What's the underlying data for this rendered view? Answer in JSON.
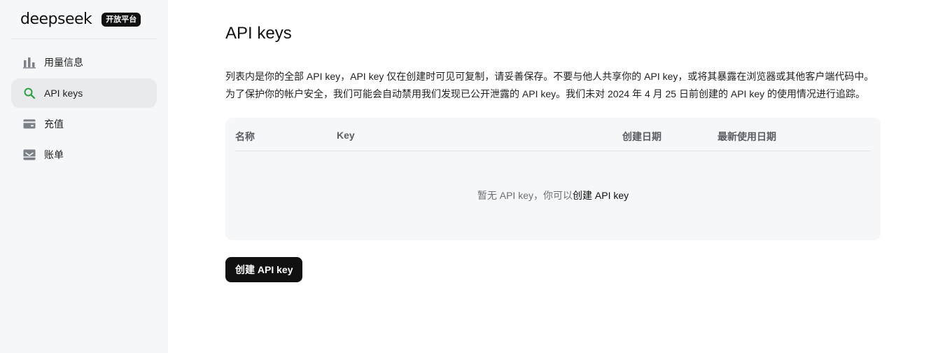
{
  "brand": {
    "name": "deepseek",
    "badge": "开放平台"
  },
  "sidebar": {
    "items": [
      {
        "label": "用量信息",
        "icon": "bar-chart-icon",
        "active": false
      },
      {
        "label": "API keys",
        "icon": "search-icon",
        "active": true,
        "icon_color": "#2e9f46"
      },
      {
        "label": "充值",
        "icon": "card-icon",
        "active": false
      },
      {
        "label": "账单",
        "icon": "inbox-icon",
        "active": false
      }
    ]
  },
  "main": {
    "title": "API keys",
    "description": [
      "列表内是你的全部 API key，API key 仅在创建时可见可复制，请妥善保存。不要与他人共享你的 API key，或将其暴露在浏览器或其他客户端代码中。",
      "为了保护你的帐户安全，我们可能会自动禁用我们发现已公开泄露的 API key。我们未对 2024 年 4 月 25 日前创建的 API key 的使用情况进行追踪。"
    ],
    "table": {
      "columns": [
        "名称",
        "Key",
        "创建日期",
        "最新使用日期"
      ],
      "empty_text": "暂无 API key，你可以",
      "empty_link": "创建 API key"
    },
    "create_button": "创建 API key"
  },
  "colors": {
    "sidebar_bg": "#f6f7f9",
    "active_bg": "#e9eaec",
    "accent_green": "#2e9f46",
    "button_bg": "#111111"
  }
}
